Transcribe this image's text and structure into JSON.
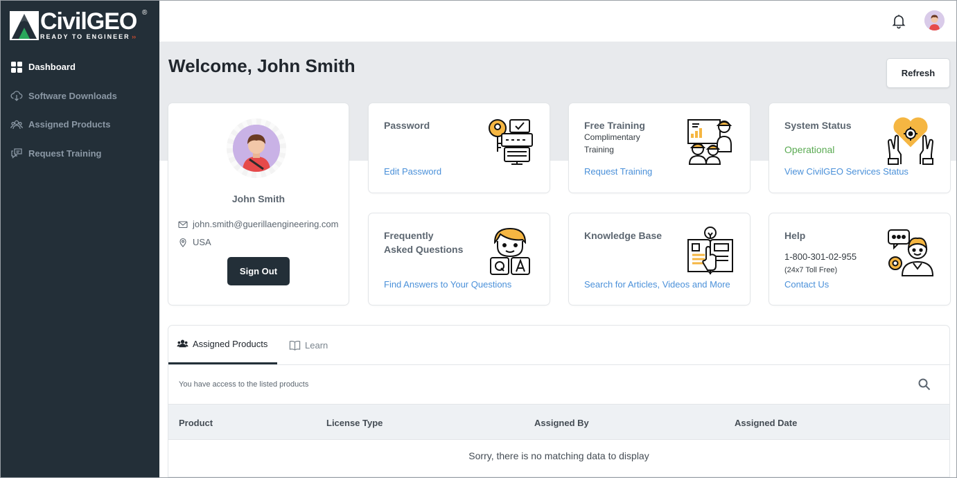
{
  "brand": {
    "name": "CivilGEO",
    "tagline": "READY TO ENGINEER",
    "registered": "®"
  },
  "sidebar": {
    "items": [
      {
        "label": "Dashboard",
        "icon": "grid-icon",
        "active": true
      },
      {
        "label": "Software Downloads",
        "icon": "cloud-download-icon"
      },
      {
        "label": "Assigned Products",
        "icon": "users-icon"
      },
      {
        "label": "Request Training",
        "icon": "chat-icon"
      }
    ]
  },
  "header": {
    "welcome": "Welcome, John Smith",
    "refresh_label": "Refresh"
  },
  "profile": {
    "name": "John Smith",
    "email": "john.smith@guerillaengineering.com",
    "country": "USA",
    "sign_out_label": "Sign Out"
  },
  "tiles": {
    "password": {
      "title": "Password",
      "link": "Edit Password"
    },
    "training": {
      "title": "Free Training",
      "sub1": "Complimentary",
      "sub2": "Training",
      "link": "Request Training"
    },
    "status": {
      "title": "System Status",
      "value": "Operational",
      "link": "View CivilGEO Services Status",
      "value_color": "#5aaa52"
    },
    "faq": {
      "title1": "Frequently",
      "title2": "Asked Questions",
      "link": "Find Answers to Your Questions"
    },
    "kb": {
      "title": "Knowledge Base",
      "link": "Search for Articles, Videos and More"
    },
    "help": {
      "title": "Help",
      "phone": "1-800-301-02-955",
      "hours": "(24x7 Toll Free)",
      "link": "Contact Us"
    }
  },
  "panel": {
    "tabs": [
      {
        "label": "Assigned Products",
        "active": true
      },
      {
        "label": "Learn",
        "active": false
      }
    ],
    "access_text": "You have access to the listed products",
    "columns": [
      "Product",
      "License Type",
      "Assigned By",
      "Assigned Date"
    ],
    "empty_text": "Sorry, there is no matching data to display"
  },
  "colors": {
    "sidebar": "#232f38",
    "accent_link": "#4a90d9",
    "illustration_orange": "#f5b642"
  }
}
